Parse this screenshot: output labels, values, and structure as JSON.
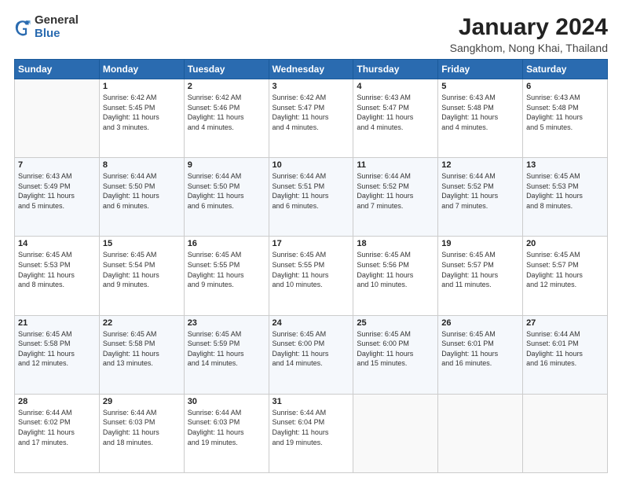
{
  "header": {
    "logo_general": "General",
    "logo_blue": "Blue",
    "main_title": "January 2024",
    "sub_title": "Sangkhom, Nong Khai, Thailand"
  },
  "calendar": {
    "days_of_week": [
      "Sunday",
      "Monday",
      "Tuesday",
      "Wednesday",
      "Thursday",
      "Friday",
      "Saturday"
    ],
    "weeks": [
      [
        {
          "day": "",
          "info": ""
        },
        {
          "day": "1",
          "info": "Sunrise: 6:42 AM\nSunset: 5:45 PM\nDaylight: 11 hours\nand 3 minutes."
        },
        {
          "day": "2",
          "info": "Sunrise: 6:42 AM\nSunset: 5:46 PM\nDaylight: 11 hours\nand 4 minutes."
        },
        {
          "day": "3",
          "info": "Sunrise: 6:42 AM\nSunset: 5:47 PM\nDaylight: 11 hours\nand 4 minutes."
        },
        {
          "day": "4",
          "info": "Sunrise: 6:43 AM\nSunset: 5:47 PM\nDaylight: 11 hours\nand 4 minutes."
        },
        {
          "day": "5",
          "info": "Sunrise: 6:43 AM\nSunset: 5:48 PM\nDaylight: 11 hours\nand 4 minutes."
        },
        {
          "day": "6",
          "info": "Sunrise: 6:43 AM\nSunset: 5:48 PM\nDaylight: 11 hours\nand 5 minutes."
        }
      ],
      [
        {
          "day": "7",
          "info": "Sunrise: 6:43 AM\nSunset: 5:49 PM\nDaylight: 11 hours\nand 5 minutes."
        },
        {
          "day": "8",
          "info": "Sunrise: 6:44 AM\nSunset: 5:50 PM\nDaylight: 11 hours\nand 6 minutes."
        },
        {
          "day": "9",
          "info": "Sunrise: 6:44 AM\nSunset: 5:50 PM\nDaylight: 11 hours\nand 6 minutes."
        },
        {
          "day": "10",
          "info": "Sunrise: 6:44 AM\nSunset: 5:51 PM\nDaylight: 11 hours\nand 6 minutes."
        },
        {
          "day": "11",
          "info": "Sunrise: 6:44 AM\nSunset: 5:52 PM\nDaylight: 11 hours\nand 7 minutes."
        },
        {
          "day": "12",
          "info": "Sunrise: 6:44 AM\nSunset: 5:52 PM\nDaylight: 11 hours\nand 7 minutes."
        },
        {
          "day": "13",
          "info": "Sunrise: 6:45 AM\nSunset: 5:53 PM\nDaylight: 11 hours\nand 8 minutes."
        }
      ],
      [
        {
          "day": "14",
          "info": "Sunrise: 6:45 AM\nSunset: 5:53 PM\nDaylight: 11 hours\nand 8 minutes."
        },
        {
          "day": "15",
          "info": "Sunrise: 6:45 AM\nSunset: 5:54 PM\nDaylight: 11 hours\nand 9 minutes."
        },
        {
          "day": "16",
          "info": "Sunrise: 6:45 AM\nSunset: 5:55 PM\nDaylight: 11 hours\nand 9 minutes."
        },
        {
          "day": "17",
          "info": "Sunrise: 6:45 AM\nSunset: 5:55 PM\nDaylight: 11 hours\nand 10 minutes."
        },
        {
          "day": "18",
          "info": "Sunrise: 6:45 AM\nSunset: 5:56 PM\nDaylight: 11 hours\nand 10 minutes."
        },
        {
          "day": "19",
          "info": "Sunrise: 6:45 AM\nSunset: 5:57 PM\nDaylight: 11 hours\nand 11 minutes."
        },
        {
          "day": "20",
          "info": "Sunrise: 6:45 AM\nSunset: 5:57 PM\nDaylight: 11 hours\nand 12 minutes."
        }
      ],
      [
        {
          "day": "21",
          "info": "Sunrise: 6:45 AM\nSunset: 5:58 PM\nDaylight: 11 hours\nand 12 minutes."
        },
        {
          "day": "22",
          "info": "Sunrise: 6:45 AM\nSunset: 5:58 PM\nDaylight: 11 hours\nand 13 minutes."
        },
        {
          "day": "23",
          "info": "Sunrise: 6:45 AM\nSunset: 5:59 PM\nDaylight: 11 hours\nand 14 minutes."
        },
        {
          "day": "24",
          "info": "Sunrise: 6:45 AM\nSunset: 6:00 PM\nDaylight: 11 hours\nand 14 minutes."
        },
        {
          "day": "25",
          "info": "Sunrise: 6:45 AM\nSunset: 6:00 PM\nDaylight: 11 hours\nand 15 minutes."
        },
        {
          "day": "26",
          "info": "Sunrise: 6:45 AM\nSunset: 6:01 PM\nDaylight: 11 hours\nand 16 minutes."
        },
        {
          "day": "27",
          "info": "Sunrise: 6:44 AM\nSunset: 6:01 PM\nDaylight: 11 hours\nand 16 minutes."
        }
      ],
      [
        {
          "day": "28",
          "info": "Sunrise: 6:44 AM\nSunset: 6:02 PM\nDaylight: 11 hours\nand 17 minutes."
        },
        {
          "day": "29",
          "info": "Sunrise: 6:44 AM\nSunset: 6:03 PM\nDaylight: 11 hours\nand 18 minutes."
        },
        {
          "day": "30",
          "info": "Sunrise: 6:44 AM\nSunset: 6:03 PM\nDaylight: 11 hours\nand 19 minutes."
        },
        {
          "day": "31",
          "info": "Sunrise: 6:44 AM\nSunset: 6:04 PM\nDaylight: 11 hours\nand 19 minutes."
        },
        {
          "day": "",
          "info": ""
        },
        {
          "day": "",
          "info": ""
        },
        {
          "day": "",
          "info": ""
        }
      ]
    ]
  }
}
